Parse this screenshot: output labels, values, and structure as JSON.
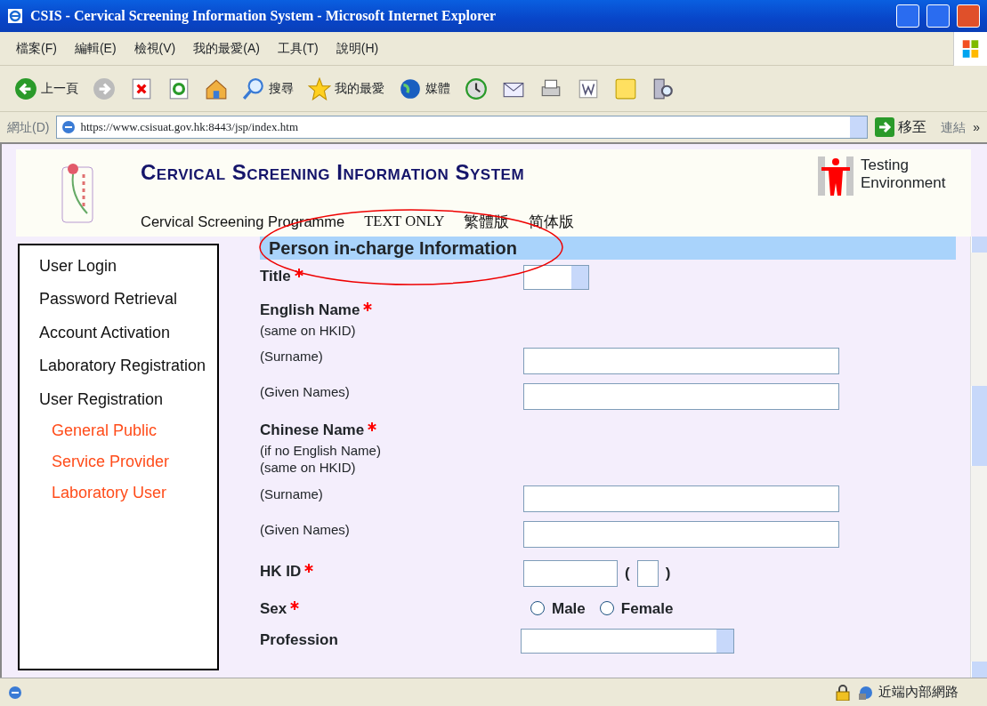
{
  "window": {
    "title": "CSIS - Cervical Screening Information System - Microsoft Internet Explorer"
  },
  "menu": [
    "檔案(F)",
    "編輯(E)",
    "檢視(V)",
    "我的最愛(A)",
    "工具(T)",
    "說明(H)"
  ],
  "toolbar": [
    {
      "kind": "back",
      "label": "上一頁"
    },
    {
      "kind": "forward"
    },
    {
      "kind": "stop"
    },
    {
      "kind": "refresh"
    },
    {
      "kind": "home"
    },
    {
      "kind": "search",
      "label": "搜尋"
    },
    {
      "kind": "favorites",
      "label": "我的最愛"
    },
    {
      "kind": "media",
      "label": "媒體"
    },
    {
      "kind": "history"
    },
    {
      "kind": "mail"
    },
    {
      "kind": "print"
    },
    {
      "kind": "edit"
    },
    {
      "kind": "note"
    },
    {
      "kind": "research"
    }
  ],
  "address": {
    "label": "網址(D)",
    "url": "https://www.csisuat.gov.hk:8443/jsp/index.htm",
    "go": "移至",
    "links": "連結",
    "more": "»"
  },
  "header": {
    "title": "Cervical Screening Information System",
    "links": [
      "Cervical Screening Programme",
      "TEXT ONLY",
      "繁體版",
      "简体版"
    ],
    "badge": "Testing Environment"
  },
  "sidebar": {
    "items": [
      {
        "label": "User Login"
      },
      {
        "label": "Password Retrieval"
      },
      {
        "label": "Account Activation"
      },
      {
        "label": "Laboratory Registration"
      },
      {
        "label": "User Registration",
        "children": [
          {
            "label": "General Public"
          },
          {
            "label": "Service Provider"
          },
          {
            "label": "Laboratory User"
          }
        ]
      }
    ]
  },
  "form": {
    "section": "Person in-charge Information",
    "fields": [
      {
        "kind": "select",
        "label": "Title",
        "required": true
      },
      {
        "kind": "heading",
        "label": "English Name",
        "required": true,
        "notes": [
          "(same on HKID)"
        ]
      },
      {
        "kind": "text",
        "label": "(Surname)"
      },
      {
        "kind": "text",
        "label": "(Given Names)"
      },
      {
        "kind": "heading",
        "label": "Chinese Name",
        "required": true,
        "notes": [
          "(if no English Name)",
          "(same on HKID)"
        ]
      },
      {
        "kind": "text",
        "label": "(Surname)"
      },
      {
        "kind": "text",
        "label": "(Given Names)"
      },
      {
        "kind": "hkid",
        "label": "HK ID",
        "required": true,
        "open": "(",
        "close": ")"
      },
      {
        "kind": "radio",
        "label": "Sex",
        "required": true,
        "options": [
          {
            "label": "Male",
            "selected": false
          },
          {
            "label": "Female",
            "selected": false
          }
        ]
      },
      {
        "kind": "wide-select",
        "label": "Profession"
      }
    ]
  },
  "status_bar": {
    "zone": "近端內部網路"
  }
}
